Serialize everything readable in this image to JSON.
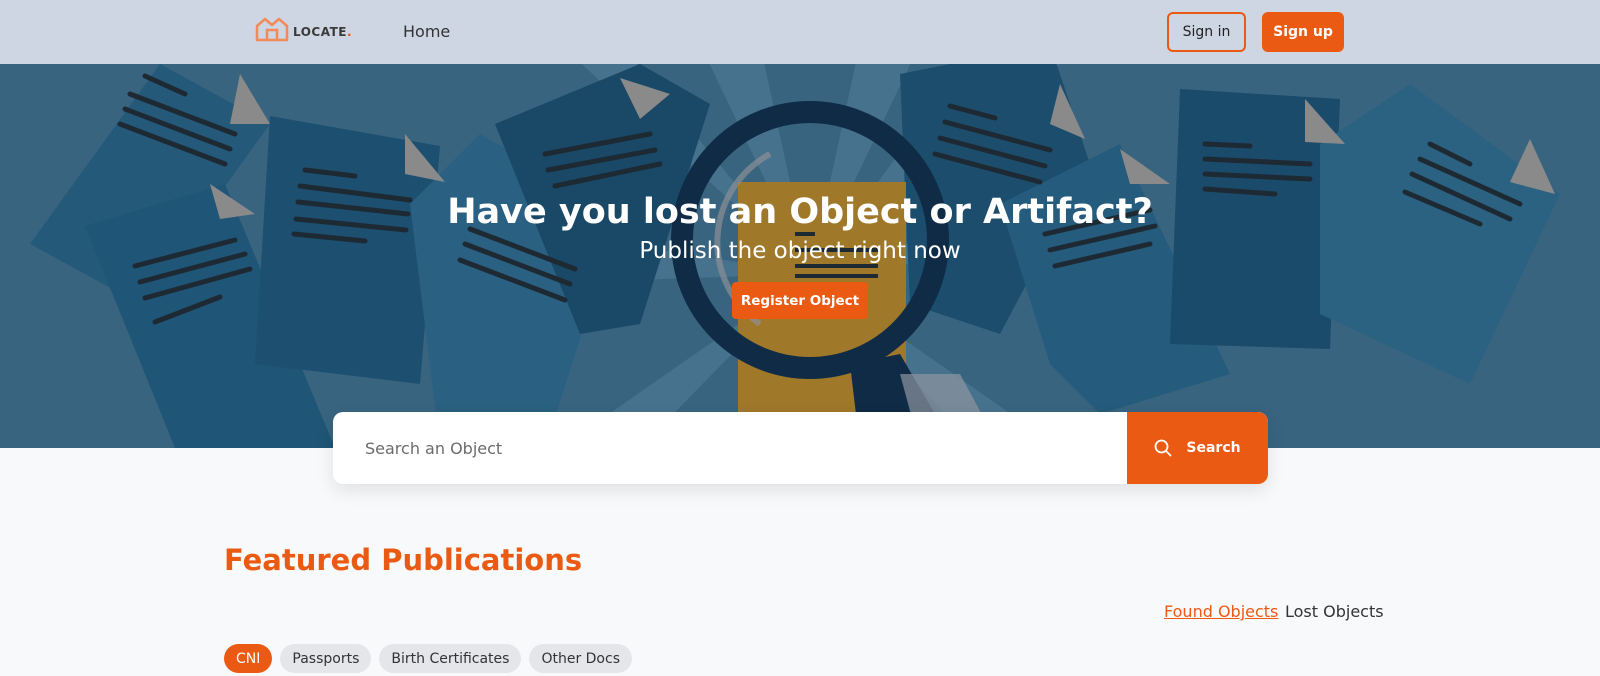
{
  "header": {
    "logo_text": "LOCATE",
    "logo_dot": ".",
    "nav_home": "Home",
    "signin_label": "Sign in",
    "signup_label": "Sign up"
  },
  "hero": {
    "title": "Have you lost an Object or Artifact?",
    "subtitle": "Publish the object right now",
    "register_label": "Register Object"
  },
  "search": {
    "placeholder": "Search an Object",
    "button_label": "Search",
    "icon": "search-icon"
  },
  "featured": {
    "title": "Featured Publications",
    "tabs": [
      {
        "label": "Found Objects",
        "active": true
      },
      {
        "label": "Lost Objects",
        "active": false
      }
    ],
    "chips": [
      {
        "label": "CNI",
        "active": true
      },
      {
        "label": "Passports",
        "active": false
      },
      {
        "label": "Birth Certificates",
        "active": false
      },
      {
        "label": "Other Docs",
        "active": false
      }
    ]
  },
  "colors": {
    "accent": "#ea5a12",
    "header_bg": "#cdd6e2",
    "hero_bg": "#386480"
  }
}
